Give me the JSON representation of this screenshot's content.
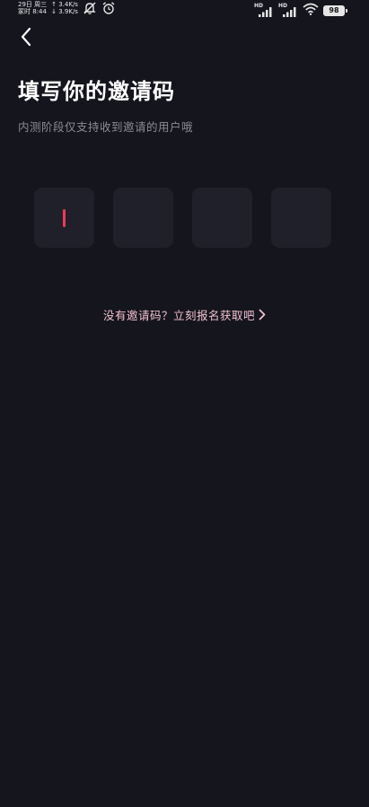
{
  "status_bar": {
    "date": "29日 周三",
    "time": "冢时 8:44",
    "upload_speed": "↑ 3.4K/s",
    "download_speed": "↓ 3.9K/s",
    "signal1_label": "HD",
    "signal2_label": "HD",
    "battery": "98"
  },
  "header": {
    "back_icon": "chevron-left-icon"
  },
  "main": {
    "title": "填写你的邀请码",
    "subtitle": "内测阶段仅支持收到邀请的用户哦",
    "code_boxes": [
      {
        "value": ""
      },
      {
        "value": ""
      },
      {
        "value": ""
      },
      {
        "value": ""
      }
    ],
    "signup_link": "没有邀请码？立刻报名获取吧"
  },
  "colors": {
    "background": "#15151d",
    "box": "#20202a",
    "cursor": "#f5355b",
    "link": "#f2c2cf",
    "subtitle": "#8b8b93"
  }
}
